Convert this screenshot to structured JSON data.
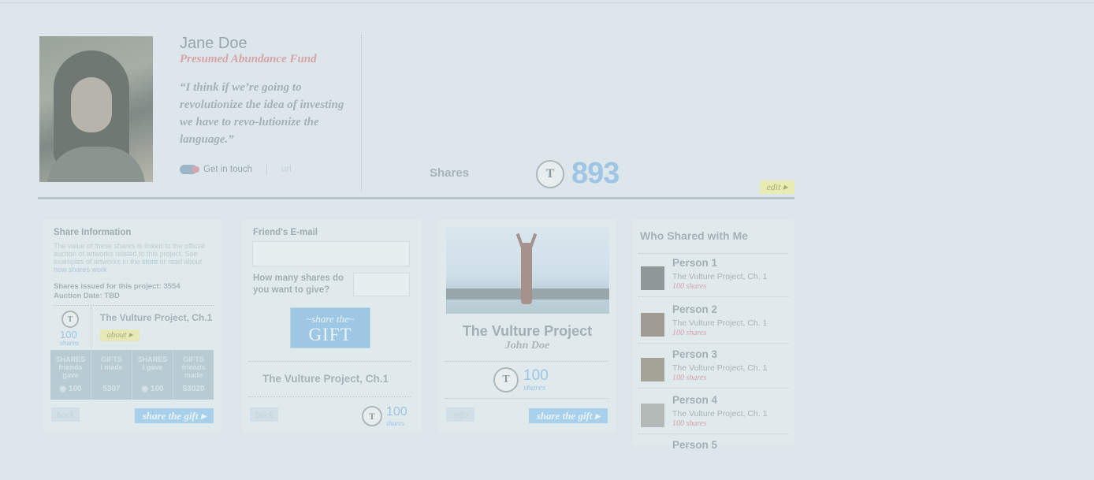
{
  "profile": {
    "name": "Jane Doe",
    "fund": "Presumed Abundance Fund",
    "quote": "“I think if we’re going to revolutionize the idea of investing we have to revo-lutionize the language.”",
    "contact_label": "Get in touch",
    "url_label": "url"
  },
  "shares_summary": {
    "label": "Shares",
    "count": "893",
    "edit_label": "edit ▸"
  },
  "share_info": {
    "title": "Share Information",
    "description": "The value of these shares is linked to the official auction of artworks related to this project. See examples of artworks in the ",
    "store_link": "store",
    "description_tail": " or read about ",
    "how_link": "how shares work",
    "issued": "Shares issued for this project: 3554",
    "auction": "Auction Date: TBD",
    "holding_count": "100",
    "holding_unit": "shares",
    "project": "The Vulture Project, Ch.1",
    "about_label": "about ▸",
    "stats": [
      {
        "title": "SHARES",
        "sub": "friends gave",
        "value": "100",
        "coin": true
      },
      {
        "title": "GIFTS",
        "sub": "I made",
        "value": "5307",
        "coin": false
      },
      {
        "title": "SHARES",
        "sub": "I gave",
        "value": "100",
        "coin": true
      },
      {
        "title": "GIFTS",
        "sub": "friends made",
        "value": "53020",
        "coin": false
      }
    ],
    "back_label": "back",
    "share_gift_label": "share the gift ▸"
  },
  "gift_form": {
    "email_label": "Friend's E-mail",
    "question": "How many shares do you want to give?",
    "button_top": "~share the~",
    "button_main": "GIFT",
    "project": "The Vulture Project, Ch.1",
    "back_label": "back",
    "count": "100",
    "unit": "shares"
  },
  "project_card": {
    "title": "The Vulture Project",
    "author": "John Doe",
    "count": "100",
    "unit": "shares",
    "info_label": "info",
    "share_gift_label": "share the gift ▸"
  },
  "who_shared": {
    "title": "Who Shared with Me",
    "people": [
      {
        "name": "Person 1",
        "project": "The Vulture Project, Ch. 1",
        "shares": "100 shares"
      },
      {
        "name": "Person 2",
        "project": "The Vulture Project, Ch. 1",
        "shares": "100 shares"
      },
      {
        "name": "Person 3",
        "project": "The Vulture Project, Ch. 1",
        "shares": "100 shares"
      },
      {
        "name": "Person 4",
        "project": "The Vulture Project, Ch. 1",
        "shares": "100 shares"
      },
      {
        "name": "Person 5",
        "project": "",
        "shares": ""
      }
    ]
  },
  "colors": {
    "background": "#dde7eb",
    "accent_blue": "#9ec5e4",
    "accent_pink": "#d6a3a8",
    "edit_yellow": "#e9ecb2"
  }
}
